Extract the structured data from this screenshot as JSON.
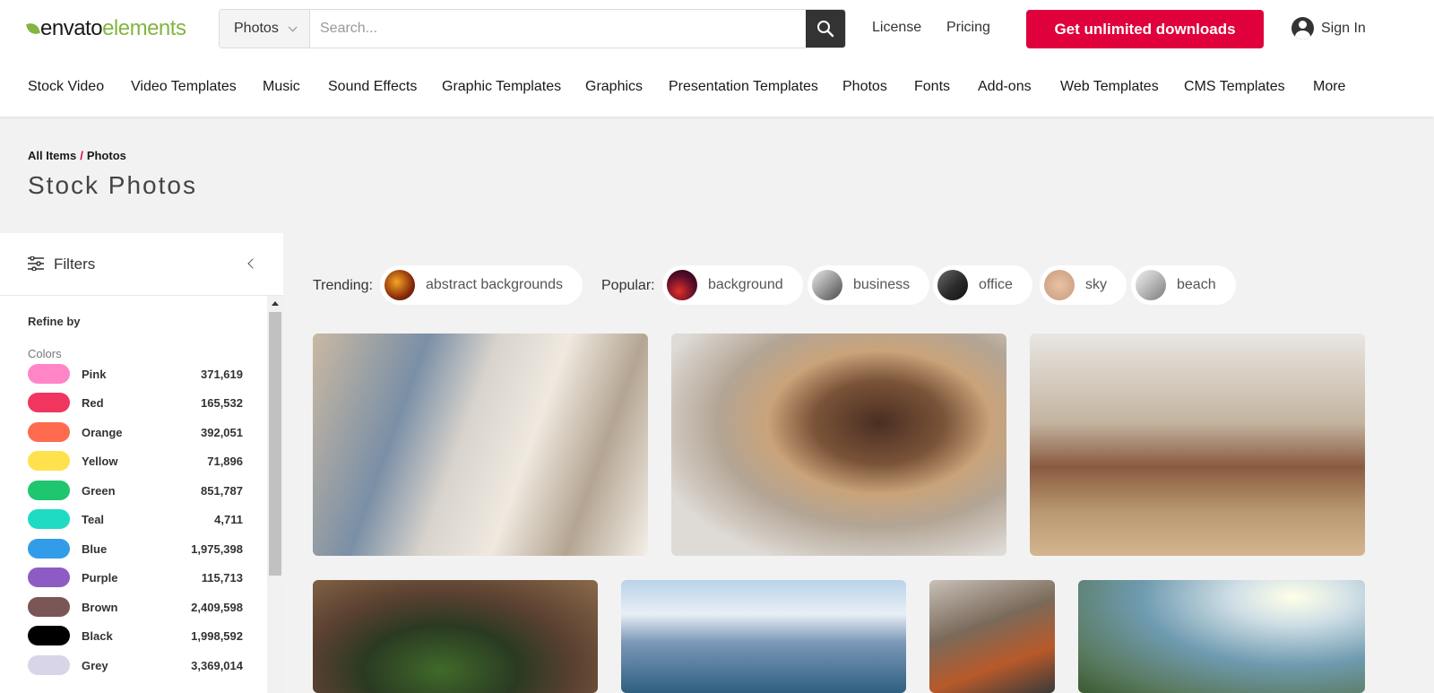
{
  "header": {
    "logo_part1": "envato",
    "logo_part2": "elements",
    "search_category": "Photos",
    "search_placeholder": "Search...",
    "license": "License",
    "pricing": "Pricing",
    "cta": "Get unlimited downloads",
    "sign_in": "Sign In"
  },
  "nav": [
    "Stock Video",
    "Video Templates",
    "Music",
    "Sound Effects",
    "Graphic Templates",
    "Graphics",
    "Presentation Templates",
    "Photos",
    "Fonts",
    "Add-ons",
    "Web Templates",
    "CMS Templates",
    "More"
  ],
  "breadcrumb": {
    "root": "All Items",
    "sep": "/",
    "current": "Photos"
  },
  "page_title": "Stock Photos",
  "sidebar": {
    "title": "Filters",
    "refine_by": "Refine by",
    "colors_heading": "Colors",
    "colors": [
      {
        "name": "Pink",
        "count": "371,619",
        "hex": "#ff85c8"
      },
      {
        "name": "Red",
        "count": "165,532",
        "hex": "#f0365f"
      },
      {
        "name": "Orange",
        "count": "392,051",
        "hex": "#ff6b4f"
      },
      {
        "name": "Yellow",
        "count": "71,896",
        "hex": "#ffe14d"
      },
      {
        "name": "Green",
        "count": "851,787",
        "hex": "#1ec66f"
      },
      {
        "name": "Teal",
        "count": "4,711",
        "hex": "#1fdbc4"
      },
      {
        "name": "Blue",
        "count": "1,975,398",
        "hex": "#339ce8"
      },
      {
        "name": "Purple",
        "count": "115,713",
        "hex": "#8c5cc4"
      },
      {
        "name": "Brown",
        "count": "2,409,598",
        "hex": "#7a5656"
      },
      {
        "name": "Black",
        "count": "1,998,592",
        "hex": "#000000"
      },
      {
        "name": "Grey",
        "count": "3,369,014",
        "hex": "#d9d5e8"
      }
    ]
  },
  "tags": {
    "trending_label": "Trending:",
    "trending": [
      "abstract backgrounds"
    ],
    "popular_label": "Popular:",
    "popular": [
      "background",
      "business",
      "office",
      "sky",
      "beach"
    ]
  },
  "colors": {
    "accent": "#e0003b",
    "brand_green": "#82b541"
  }
}
